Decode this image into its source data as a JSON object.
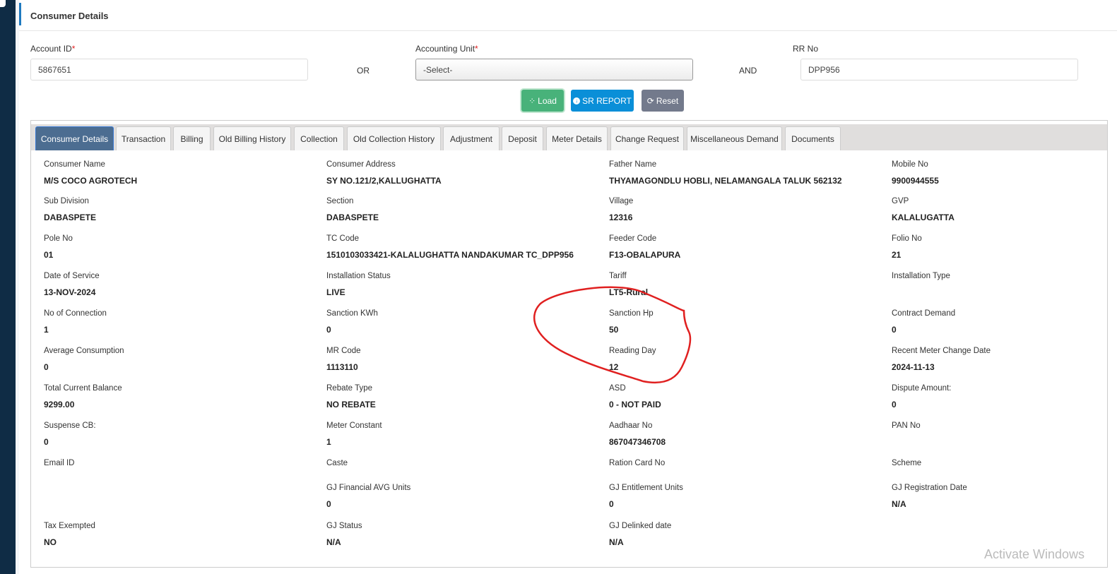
{
  "page": {
    "title": "Consumer Details"
  },
  "search": {
    "account_id_label": "Account ID",
    "account_id_value": "5867651",
    "or_label": "OR",
    "accounting_unit_label": "Accounting Unit",
    "accounting_unit_value": "-Select-",
    "and_label": "AND",
    "rr_no_label": "RR No",
    "rr_no_value": "DPP956",
    "required_mark": "*"
  },
  "buttons": {
    "load": "Load",
    "sr_report": "SR REPORT",
    "reset": "Reset"
  },
  "colors": {
    "load": "#48b27a",
    "sr_report": "#0a8fd8",
    "reset": "#737a8c",
    "active_tab": "#4c6d91",
    "annotation": "#e02020"
  },
  "tabs": [
    {
      "label": "Consumer Details",
      "active": true
    },
    {
      "label": "Transaction"
    },
    {
      "label": "Billing"
    },
    {
      "label": "Old Billing History"
    },
    {
      "label": "Collection"
    },
    {
      "label": "Old Collection History"
    },
    {
      "label": "Adjustment"
    },
    {
      "label": "Deposit"
    },
    {
      "label": "Meter Details"
    },
    {
      "label": "Change Request"
    },
    {
      "label": "Miscellaneous Demand"
    },
    {
      "label": "Documents"
    }
  ],
  "details": [
    [
      {
        "label": "Consumer Name",
        "value": "M/S COCO AGROTECH"
      },
      {
        "label": "Consumer Address",
        "value": "SY NO.121/2,KALLUGHATTA"
      },
      {
        "label": "Father Name",
        "value": "THYAMAGONDLU HOBLI, NELAMANGALA TALUK 562132"
      },
      {
        "label": "Mobile No",
        "value": "9900944555"
      }
    ],
    [
      {
        "label": "Sub Division",
        "value": "DABASPETE"
      },
      {
        "label": "Section",
        "value": "DABASPETE"
      },
      {
        "label": "Village",
        "value": "12316"
      },
      {
        "label": "GVP",
        "value": "KALALUGATTA"
      }
    ],
    [
      {
        "label": "Pole No",
        "value": "01"
      },
      {
        "label": "TC Code",
        "value": "1510103033421-KALALUGHATTA NANDAKUMAR TC_DPP956"
      },
      {
        "label": "Feeder Code",
        "value": "F13-OBALAPURA"
      },
      {
        "label": "Folio No",
        "value": "21"
      }
    ],
    [
      {
        "label": "Date of Service",
        "value": "13-NOV-2024"
      },
      {
        "label": "Installation Status",
        "value": "LIVE"
      },
      {
        "label": "Tariff",
        "value": "LT5-Rural"
      },
      {
        "label": "Installation Type",
        "value": ""
      }
    ],
    [
      {
        "label": "No of Connection",
        "value": "1"
      },
      {
        "label": "Sanction KWh",
        "value": "0"
      },
      {
        "label": "Sanction Hp",
        "value": "50"
      },
      {
        "label": "Contract Demand",
        "value": "0"
      }
    ],
    [
      {
        "label": "Average Consumption",
        "value": "0"
      },
      {
        "label": "MR Code",
        "value": "1113110"
      },
      {
        "label": "Reading Day",
        "value": "12"
      },
      {
        "label": "Recent Meter Change Date",
        "value": "2024-11-13"
      }
    ],
    [
      {
        "label": "Total Current Balance",
        "value": "9299.00"
      },
      {
        "label": "Rebate Type",
        "value": "NO REBATE"
      },
      {
        "label": "ASD",
        "value": "0 - NOT PAID"
      },
      {
        "label": "Dispute Amount:",
        "value": "0"
      }
    ],
    [
      {
        "label": "Suspense CB:",
        "value": "0"
      },
      {
        "label": "Meter Constant",
        "value": "1"
      },
      {
        "label": "Aadhaar No",
        "value": "867047346708"
      },
      {
        "label": "PAN No",
        "value": ""
      }
    ],
    [
      {
        "label": "Email ID",
        "value": ""
      },
      {
        "label": "Caste",
        "value": ""
      },
      {
        "label": "Ration Card No",
        "value": ""
      },
      {
        "label": "Scheme",
        "value": ""
      }
    ],
    [
      null,
      {
        "label": "GJ Financial AVG Units",
        "value": "0"
      },
      {
        "label": "GJ Entitlement Units",
        "value": "0"
      },
      {
        "label": "GJ Registration Date",
        "value": "N/A"
      }
    ],
    [
      {
        "label": "Tax Exempted",
        "value": "NO"
      },
      {
        "label": "GJ Status",
        "value": "N/A"
      },
      {
        "label": "GJ Delinked date",
        "value": "N/A"
      },
      null
    ]
  ],
  "watermark": "Activate Windows"
}
